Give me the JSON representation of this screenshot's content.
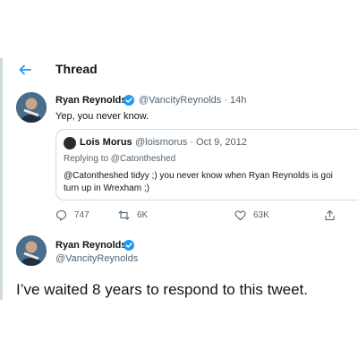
{
  "header": {
    "title": "Thread",
    "back_icon": "arrow-left-icon"
  },
  "tweet": {
    "author_name": "Ryan Reynolds",
    "author_meta": "@VancityReynolds · 14h",
    "text": "Yep, you never know.",
    "quoted": {
      "author_name": "Lois Morus",
      "author_meta": "@loismorus · Oct 9, 2012",
      "replying_to": "Replying to @Catontheshed",
      "text_line1": "@Catontheshed tidyy ;) you never know when Ryan Reynolds is goi",
      "text_line2": "turn up in Wrexham ;)"
    },
    "actions": {
      "replies": "747",
      "retweets": "6K",
      "likes": "63K"
    }
  },
  "reply": {
    "author_name": "Ryan Reynolds",
    "author_handle": "@VancityReynolds",
    "text": "I’ve waited 8 years to respond to this tweet."
  },
  "colors": {
    "accent": "#1d9bf0",
    "muted": "#536471",
    "text": "#0f1419"
  }
}
